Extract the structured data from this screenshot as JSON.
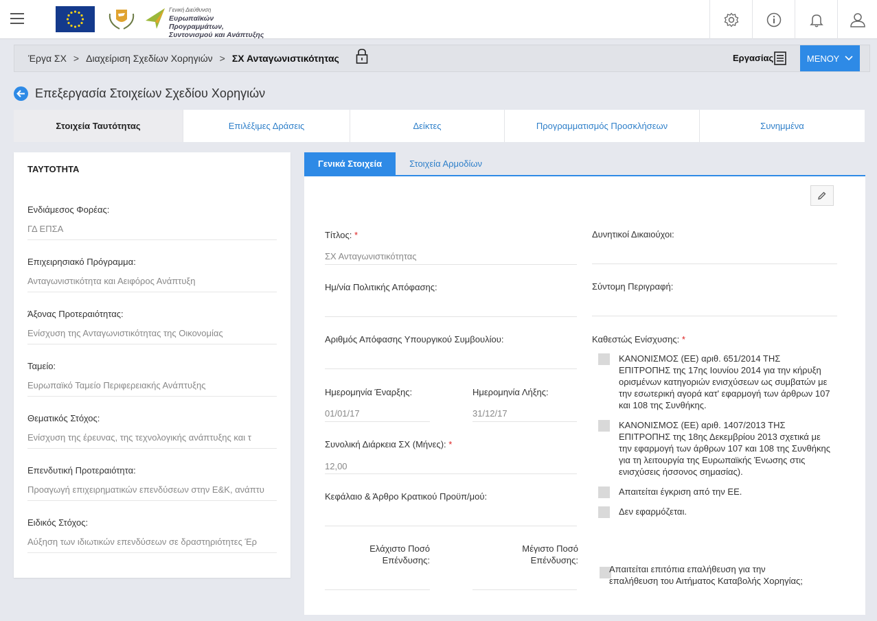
{
  "header": {
    "logo_text_small": "Γενική Διεύθυνση",
    "logo_text_main": "Ευρωπαϊκών Προγραμμάτων, Συντονισμού και Ανάπτυξης"
  },
  "breadcrumb": {
    "item1": "Έργα ΣΧ",
    "item2": "Διαχείριση Σχεδίων Χορηγιών",
    "current": "ΣΧ Ανταγωνιστικότητας",
    "sep": ">",
    "work_label": "Εργασίας",
    "menu_label": "ΜΕΝΟΥ"
  },
  "page_title": "Επεξεργασία Στοιχείων Σχεδίου Χορηγιών",
  "tabs": [
    {
      "label": "Στοιχεία Ταυτότητας"
    },
    {
      "label": "Επιλέξιμες Δράσεις"
    },
    {
      "label": "Δείκτες"
    },
    {
      "label": "Προγραμματισμός Προσκλήσεων"
    },
    {
      "label": "Συνημμένα"
    }
  ],
  "identity": {
    "title": "ΤΑΥΤΟΤΗΤΑ",
    "fields": [
      {
        "label": "Ενδιάμεσος Φορέας:",
        "value": "ΓΔ ΕΠΣΑ"
      },
      {
        "label": "Επιχειρησιακό Πρόγραμμα:",
        "value": "Ανταγωνιστικότητα και Αειφόρος Ανάπτυξη"
      },
      {
        "label": "Άξονας Προτεραιότητας:",
        "value": "Ενίσχυση της Ανταγωνιστικότητας της Οικονομίας"
      },
      {
        "label": "Ταμείο:",
        "value": "Ευρωπαϊκό Ταμείο Περιφερειακής Ανάπτυξης"
      },
      {
        "label": "Θεματικός Στόχος:",
        "value": "Ενίσχυση  της έρευνας, της τεχνολογικής ανάπτυξης  και  τ"
      },
      {
        "label": "Επενδυτική Προτεραιότητα:",
        "value": "Προαγωγή επιχειρηματικών επενδύσεων στην Ε&Κ, ανάπτυ"
      },
      {
        "label": "Ειδικός Στόχος:",
        "value": "Αύξηση των ιδιωτικών επενδύσεων σε δραστηριότητες Έρ"
      }
    ]
  },
  "subtabs": [
    {
      "label": "Γενικά Στοιχεία"
    },
    {
      "label": "Στοιχεία Αρμοδίων"
    }
  ],
  "form": {
    "required_mark": "*",
    "title_label": "Τίτλος:",
    "title_value": "ΣΧ Ανταγωνιστικότητας",
    "decision_date_label": "Ημ/νία Πολιτικής Απόφασης:",
    "cabinet_decision_label": "Αριθμός Απόφασης Υπουργικού Συμβουλίου:",
    "start_date_label": "Ημερομηνία Έναρξης:",
    "start_date_value": "01/01/17",
    "end_date_label": "Ημερομηνία Λήξης:",
    "end_date_value": "31/12/17",
    "duration_label": "Συνολική Διάρκεια ΣΧ (Μήνες):",
    "duration_value": "12,00",
    "budget_label": "Κεφάλαιο & Άρθρο Κρατικού Προϋπ/μού:",
    "min_invest_label": "Ελάχιστο Ποσό Επένδυσης:",
    "max_invest_label": "Μέγιστο Ποσό Επένδυσης:",
    "beneficiaries_label": "Δυνητικοί Δικαιούχοι:",
    "short_desc_label": "Σύντομη Περιγραφή:",
    "aid_status_label": "Καθεστώς Ενίσχυσης:",
    "aid_options": [
      "ΚΑΝΟΝΙΣΜΟΣ (ΕΕ) αριθ. 651/2014 ΤΗΣ ΕΠΙΤΡΟΠΗΣ της 17ης Ιουνίου 2014 για την κήρυξη ορισμένων κατηγοριών ενισχύσεων ως συμβατών με την εσωτερική αγορά κατ' εφαρμογή των άρθρων 107 και 108 της Συνθήκης.",
      "ΚΑΝΟΝΙΣΜΟΣ (ΕΕ) αριθ. 1407/2013 ΤΗΣ ΕΠΙΤΡΟΠΗΣ της 18ης Δεκεμβρίου 2013 σχετικά με την εφαρμογή των άρθρων 107 και 108 της Συνθήκης για τη λειτουργία της Ευρωπαϊκής Ένωσης στις ενισχύσεις ήσσονος σημασίας).",
      "Απαιτείται έγκριση από την ΕΕ.",
      "Δεν εφαρμόζεται."
    ],
    "onsite_check_label": "Απαιτείται επιτόπια επαλήθευση για την επαλήθευση του Αιτήματος Καταβολής Χορηγίας;"
  },
  "colors": {
    "accent": "#2e8ae6",
    "background": "#e6e8ee"
  }
}
